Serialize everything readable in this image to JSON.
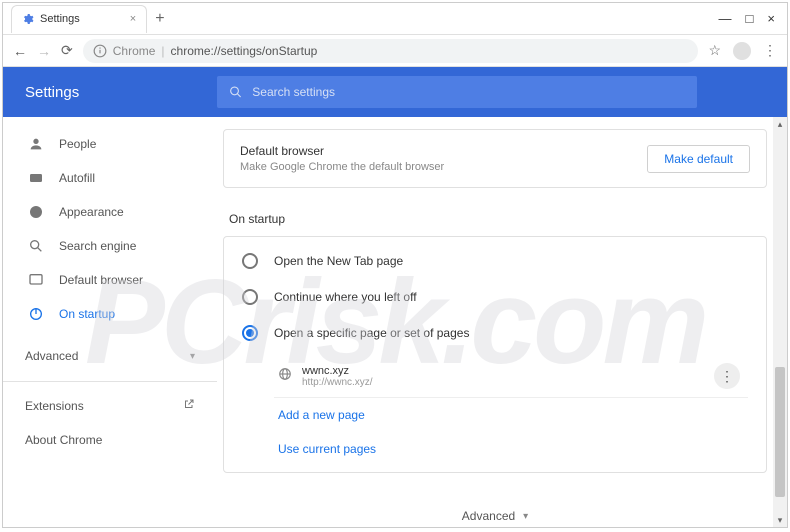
{
  "window": {
    "tab_title": "Settings",
    "tab_close": "×",
    "new_tab": "+",
    "minimize": "—",
    "maximize": "□",
    "close": "×"
  },
  "omnibar": {
    "proto_label": "Chrome",
    "url_display": "chrome://settings/onStartup"
  },
  "header": {
    "title": "Settings",
    "search_placeholder": "Search settings"
  },
  "sidebar": {
    "items": [
      {
        "label": "People"
      },
      {
        "label": "Autofill"
      },
      {
        "label": "Appearance"
      },
      {
        "label": "Search engine"
      },
      {
        "label": "Default browser"
      },
      {
        "label": "On startup"
      }
    ],
    "advanced": "Advanced",
    "extensions": "Extensions",
    "about": "About Chrome"
  },
  "default_browser_card": {
    "cutoff_heading": "Default browser",
    "title": "Default browser",
    "subtitle": "Make Google Chrome the default browser",
    "button": "Make default"
  },
  "startup": {
    "heading": "On startup",
    "options": [
      {
        "label": "Open the New Tab page"
      },
      {
        "label": "Continue where you left off"
      },
      {
        "label": "Open a specific page or set of pages"
      }
    ],
    "page_entry": {
      "name": "wwnc.xyz",
      "url": "http://wwnc.xyz/"
    },
    "add_link": "Add a new page",
    "use_current": "Use current pages"
  },
  "footer": {
    "advanced": "Advanced"
  },
  "watermark": "PCrisk.com"
}
